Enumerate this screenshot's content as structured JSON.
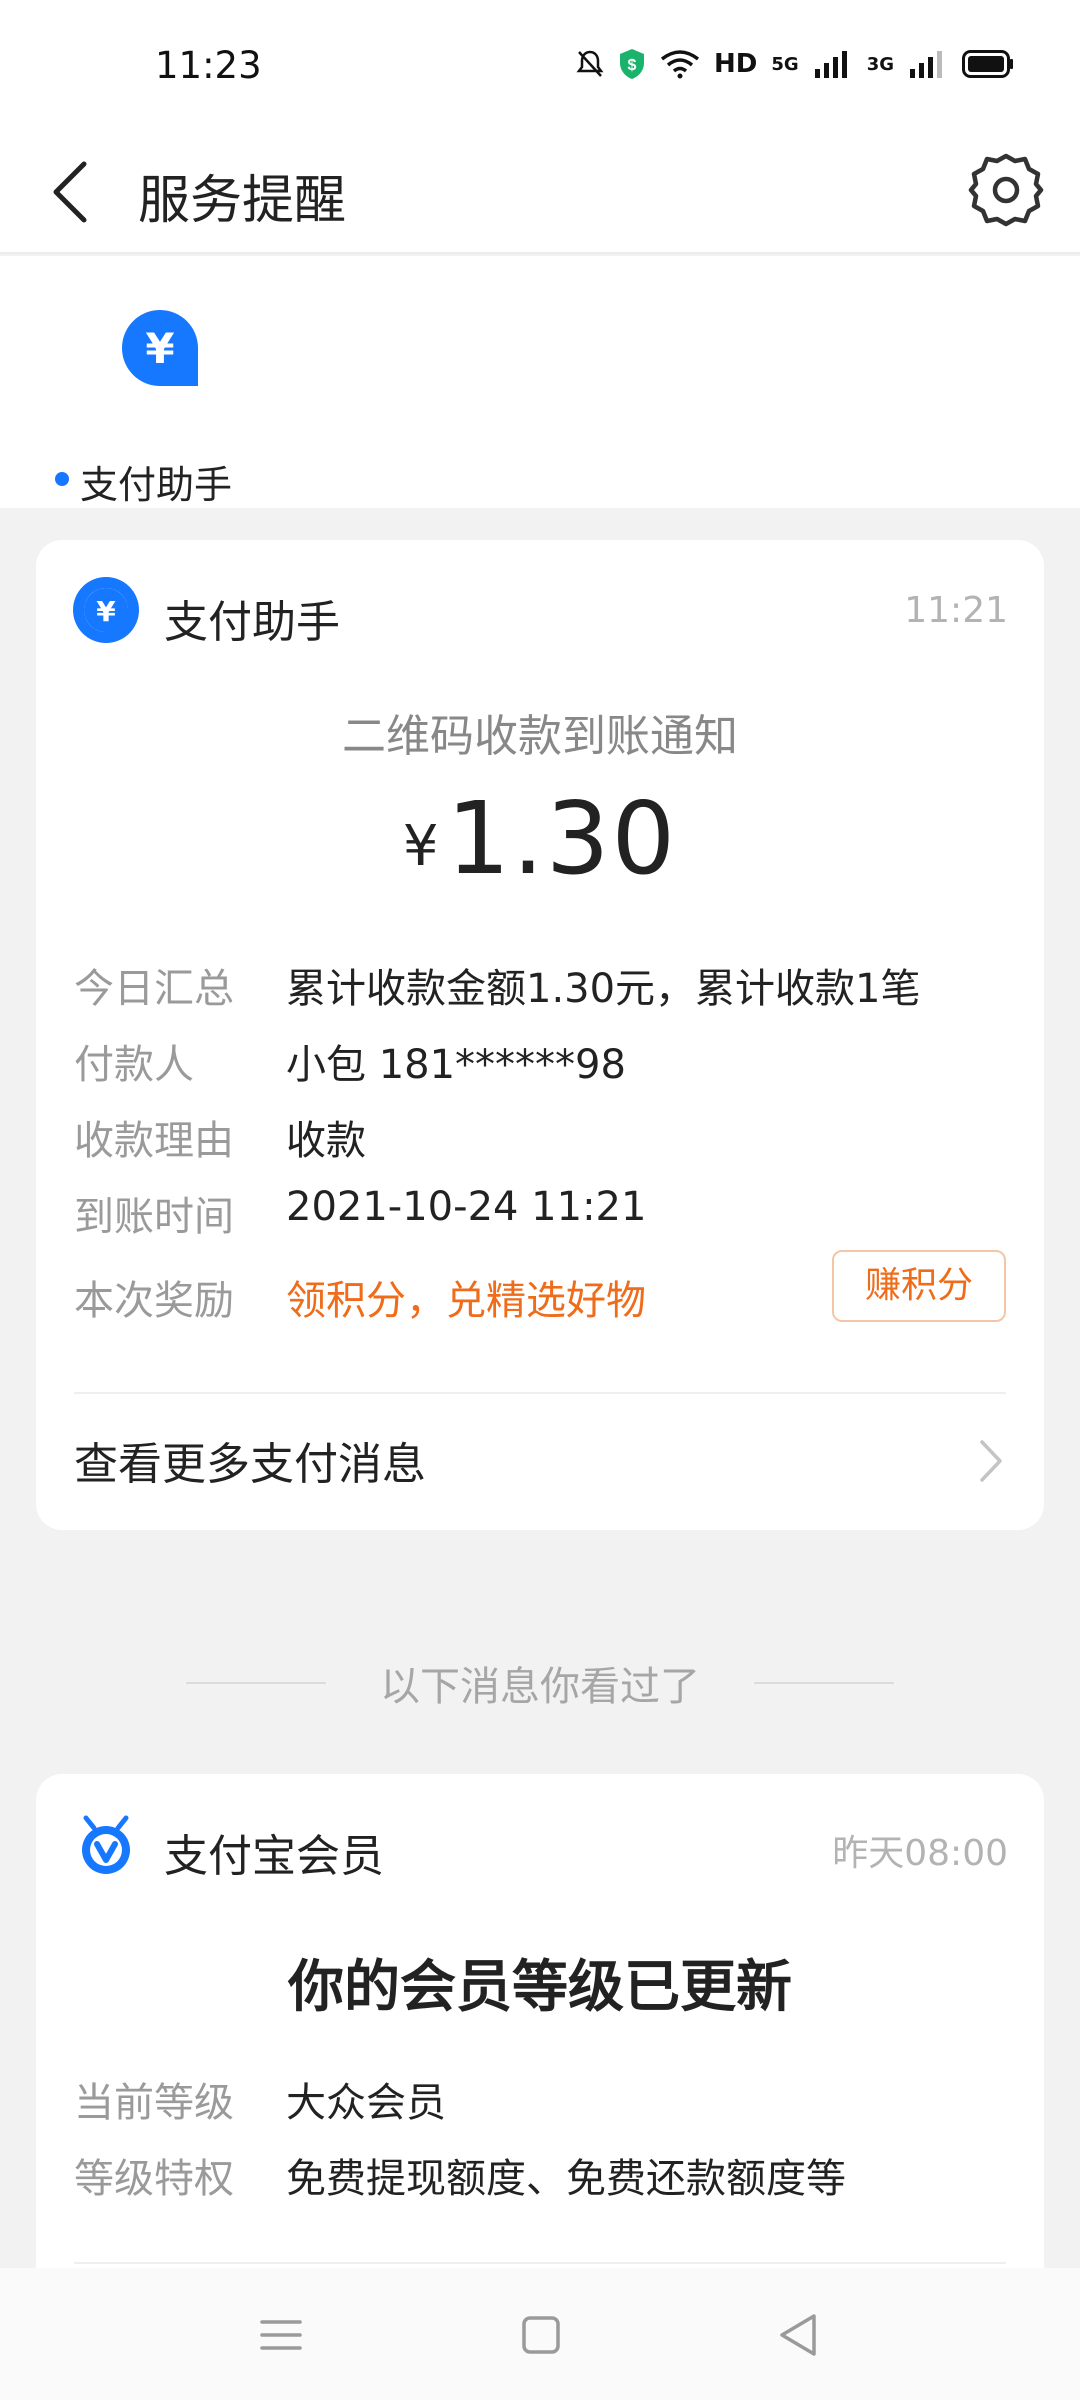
{
  "status_bar": {
    "time": "11:23",
    "hd_label": "HD",
    "net1": "5G",
    "net2": "3G"
  },
  "header": {
    "title": "服务提醒"
  },
  "tabs": [
    {
      "label": "支付助手",
      "unread": true,
      "icon": "yuan-bubble-icon",
      "color": "#1677ff"
    }
  ],
  "payment_card": {
    "sender": "支付助手",
    "time": "11:21",
    "notice_title": "二维码收款到账通知",
    "currency_symbol": "¥",
    "amount": "1.30",
    "rows": [
      {
        "label": "今日汇总",
        "value": "累计收款金额1.30元，累计收款1笔"
      },
      {
        "label": "付款人",
        "value": "小包 181******98"
      },
      {
        "label": "收款理由",
        "value": "收款"
      },
      {
        "label": "到账时间",
        "value": "2021-10-24 11:21"
      },
      {
        "label": "本次奖励",
        "value": "领积分，兑精选好物"
      }
    ],
    "reward_button": "赚积分",
    "more_link": "查看更多支付消息",
    "accent_color": "#ef6c1a"
  },
  "seen_divider": "以下消息你看过了",
  "member_card": {
    "sender": "支付宝会员",
    "time": "昨天08:00",
    "title": "你的会员等级已更新",
    "rows": [
      {
        "label": "当前等级",
        "value": "大众会员"
      },
      {
        "label": "等级特权",
        "value": "免费提现额度、免费还款额度等"
      }
    ]
  }
}
